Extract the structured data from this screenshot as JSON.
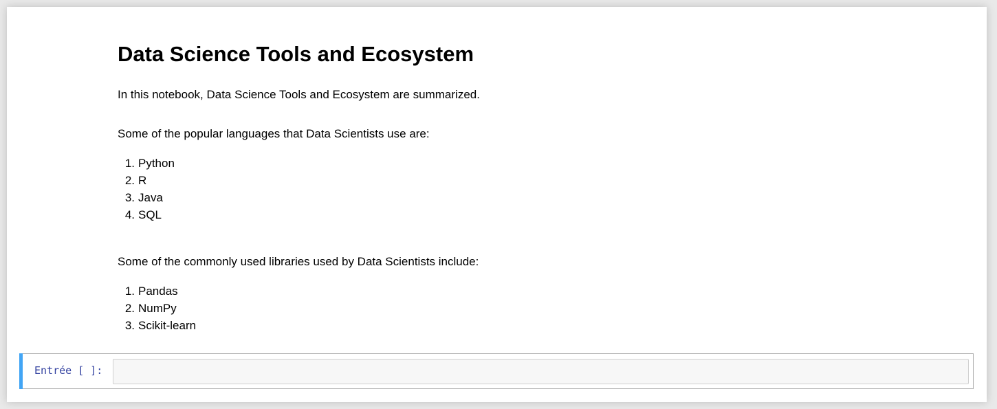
{
  "markdown": {
    "title": "Data Science Tools and Ecosystem",
    "intro": "In this notebook, Data Science Tools and Ecosystem are summarized.",
    "languages_heading": "Some of the popular languages that Data Scientists use are:",
    "languages": [
      "Python",
      "R",
      "Java",
      "SQL"
    ],
    "libraries_heading": "Some of the commonly used libraries used by Data Scientists include:",
    "libraries": [
      "Pandas",
      "NumPy",
      "Scikit-learn"
    ]
  },
  "code_cell": {
    "prompt": "Entrée [ ]:",
    "value": ""
  },
  "colors": {
    "accent_bar": "#42a5f5",
    "prompt": "#303f9f"
  }
}
